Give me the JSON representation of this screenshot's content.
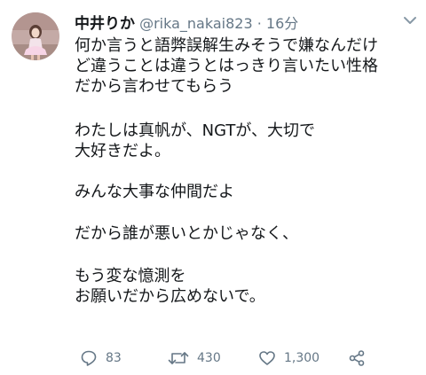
{
  "tweet": {
    "display_name": "中井りか",
    "handle": "@rika_nakai823",
    "separator": "·",
    "time": "16分",
    "lines": [
      "何か言うと語弊誤解生みそうで嫌なんだけ",
      "ど違うことは違うとはっきり言いたい性格",
      "だから言わせてもらう",
      "わたしは真帆が、NGTが、大切で",
      "大好きだよ。",
      "みんな大事な仲間だよ",
      "だから誰が悪いとかじゃなく、",
      "もう変な憶測を",
      "お願いだから広めないで。"
    ]
  },
  "actions": {
    "reply_count": "83",
    "retweet_count": "430",
    "like_count": "1,300"
  },
  "icons": {
    "reply": "reply-icon",
    "retweet": "retweet-icon",
    "like": "heart-icon",
    "share": "share-icon",
    "more": "chevron-down-icon"
  },
  "colors": {
    "text": "#14171a",
    "secondary": "#657786"
  }
}
